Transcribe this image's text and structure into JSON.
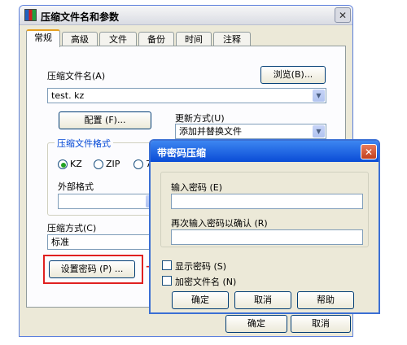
{
  "main_window": {
    "title": "压缩文件名和参数",
    "tabs": [
      "常规",
      "高级",
      "文件",
      "备份",
      "时间",
      "注释"
    ],
    "archive_name_label": "压缩文件名(A)",
    "archive_name_value": "test. kz",
    "browse_button": "浏览(B)...",
    "config_button": "配置 (F)...",
    "update_method_label": "更新方式(U)",
    "update_method_value": "添加并替换文件",
    "format_group_title": "压缩文件格式",
    "format_options": [
      "KZ",
      "ZIP",
      "7Z"
    ],
    "format_selected": "KZ",
    "external_format_label": "外部格式",
    "external_format_value": "",
    "compression_label": "压缩方式(C)",
    "compression_value": "标准",
    "set_password_button": "设置密码 (P) ...",
    "ok_button_partial": "确定",
    "cancel_button_partial": "取消"
  },
  "password_dialog": {
    "title": "带密码压缩",
    "enter_password_label": "输入密码 (E)",
    "enter_password_value": "",
    "confirm_password_label": "再次输入密码以确认 (R)",
    "confirm_password_value": "",
    "show_password_label": "显示密码 (S)",
    "show_password_checked": false,
    "encrypt_names_label": "加密文件名 (N)",
    "encrypt_names_checked": false,
    "ok_button": "确定",
    "cancel_button": "取消",
    "help_button": "帮助"
  },
  "colors": {
    "highlight": "#e02020",
    "dialog_title_bar": "#0a4cd6",
    "window_bg": "#ece9d8"
  },
  "icons": {
    "app_icon": "winrar-books-icon",
    "arrow": "red-right-arrow-icon"
  }
}
